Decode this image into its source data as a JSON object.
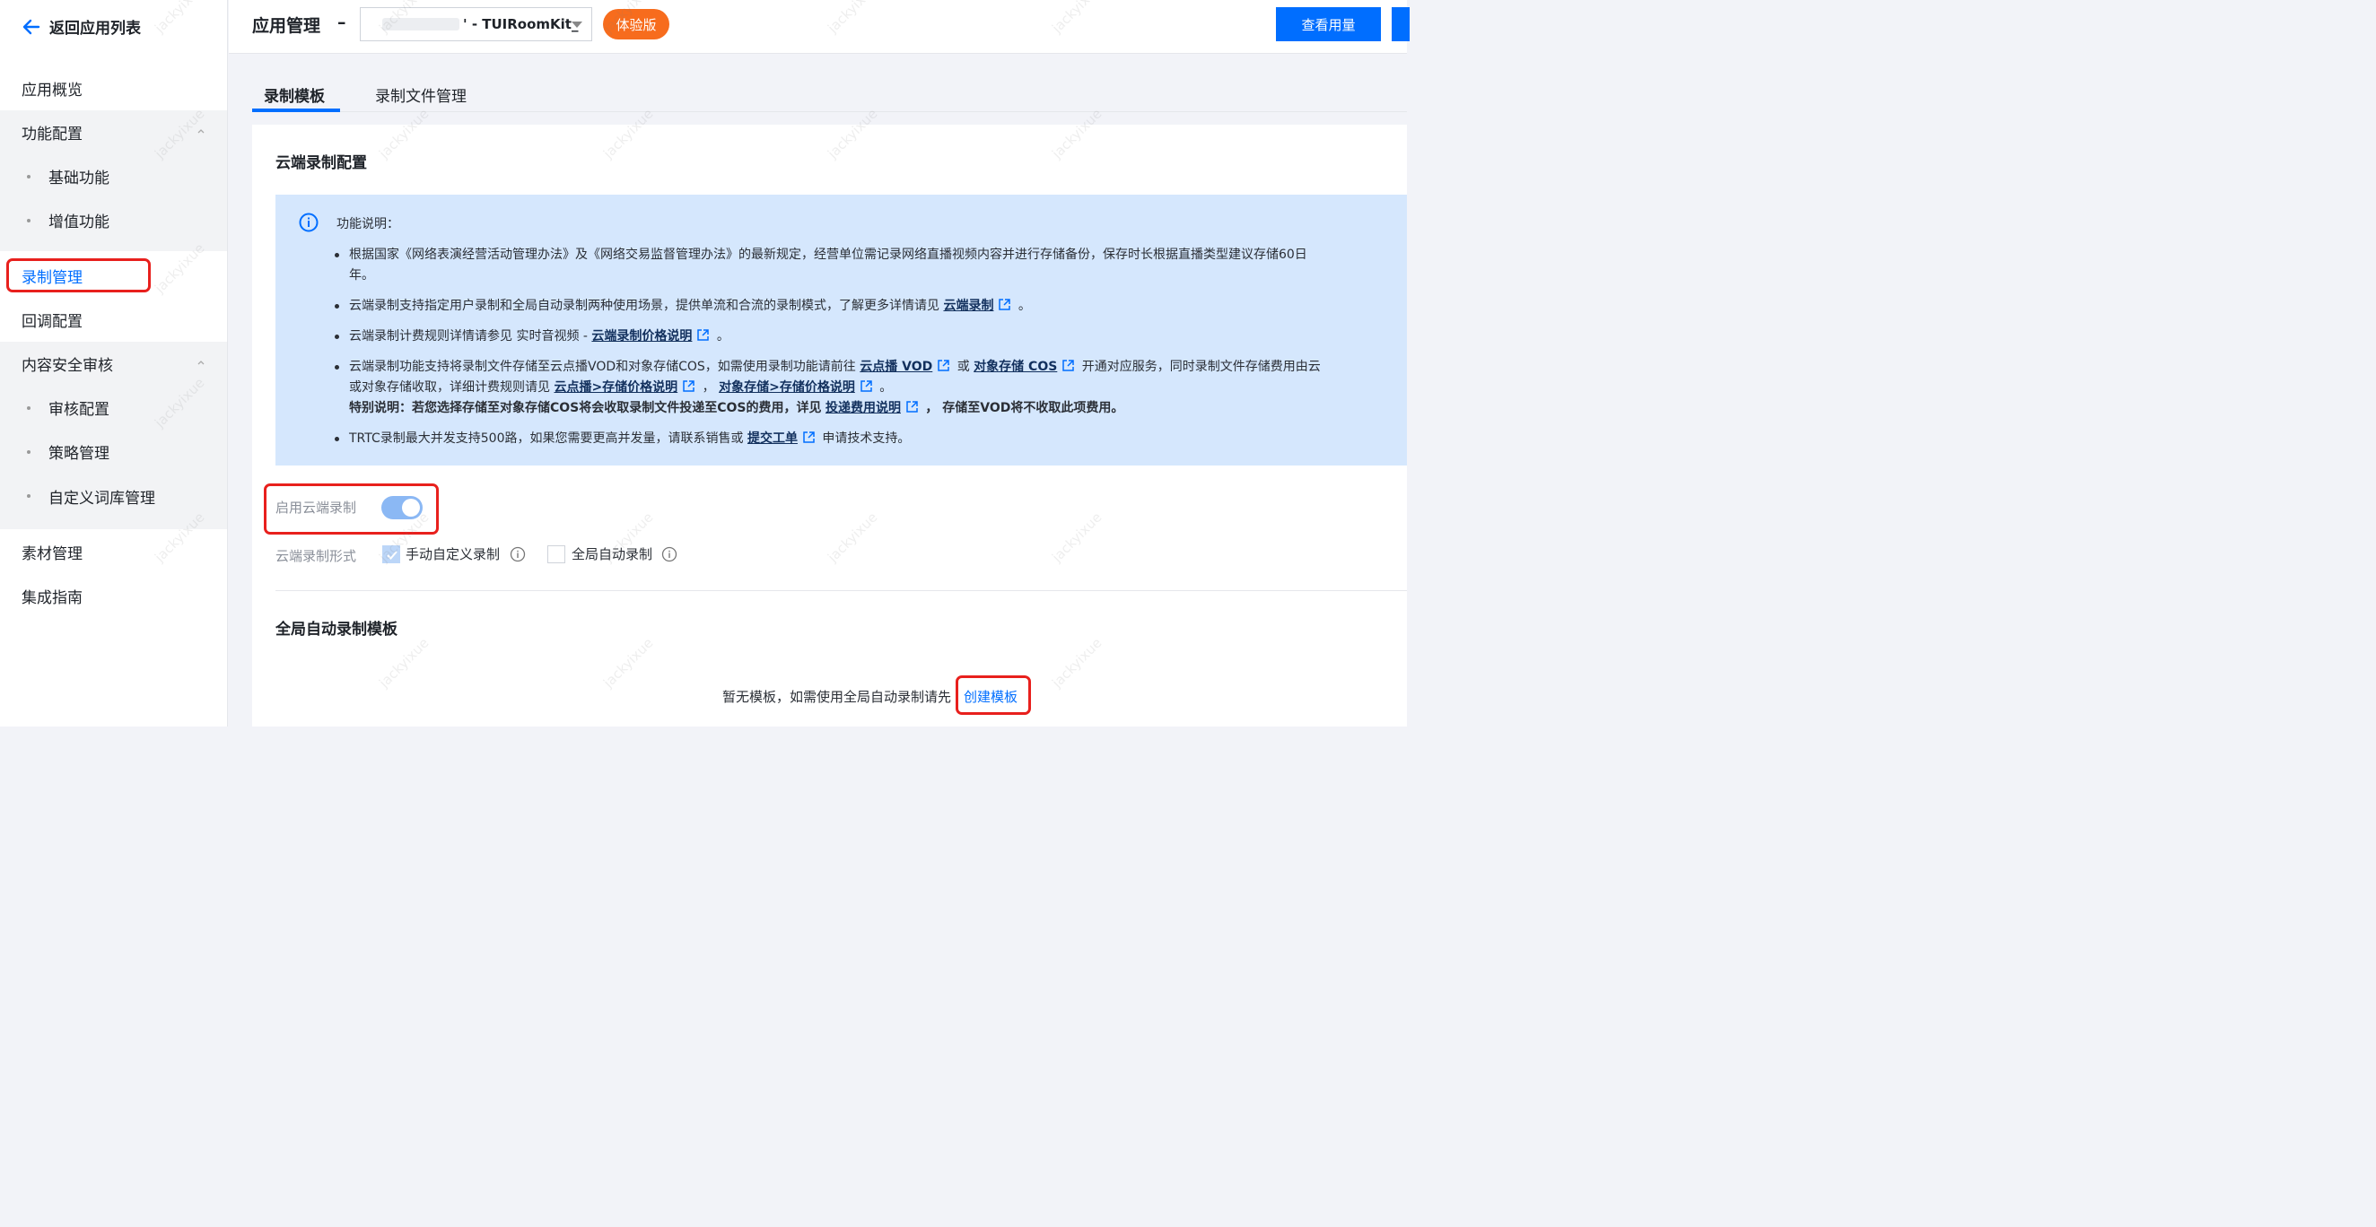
{
  "sidebar": {
    "back_label": "返回应用列表",
    "items": {
      "overview": "应用概览",
      "feature_config": "功能配置",
      "basic": "基础功能",
      "value_added": "增值功能",
      "recording": "录制管理",
      "callback": "回调配置",
      "content_audit": "内容安全审核",
      "audit_config": "审核配置",
      "policy": "策略管理",
      "dictionary": "自定义词库管理",
      "material": "素材管理",
      "guide": "集成指南"
    }
  },
  "topbar": {
    "title": "应用管理",
    "dash": "–",
    "app_name": "' - TUIRoomKit_",
    "badge": "体验版",
    "usage_button": "查看用量"
  },
  "tabs": [
    "录制模板",
    "录制文件管理"
  ],
  "card": {
    "title": "云端录制配置",
    "info": {
      "heading": "功能说明：",
      "b1_line1": "根据国家《网络表演经营活动管理办法》及《网络交易监督管理办法》的最新规定，经营单位需记录网络直播视频内容并进行存储备份，保存时长根据直播类型建议存储60日",
      "b1_line2": "年。",
      "b2_text": "云端录制支持指定用户录制和全局自动录制两种使用场景，提供单流和合流的录制模式，了解更多详情请见",
      "b2_link": "云端录制",
      "b2_end": "。",
      "b3_text": "云端录制计费规则详情请参见 实时音视频 -",
      "b3_link": "云端录制价格说明",
      "b3_end": "。",
      "b4_text1": "云端录制功能支持将录制文件存储至云点播VOD和对象存储COS，如需使用录制功能请前往",
      "b4_link1": "云点播 VOD",
      "b4_or": "或",
      "b4_link2": "对象存储 COS",
      "b4_text2": "开通对应服务，同时录制文件存储费用由云",
      "b4_line2_text": "或对象存储收取，详细计费规则请见",
      "b4_link3": "云点播>存储价格说明",
      "b4_comma": "，",
      "b4_link4": "对象存储>存储价格说明",
      "b4_end": "。",
      "b4_special": "特别说明：若您选择存储至对象存储COS将会收取录制文件投递至COS的费用，详见",
      "b4_link5": "投递费用说明",
      "b4_special_end": "，  存储至VOD将不收取此项费用。",
      "b5_text": "TRTC录制最大并发支持500路，如果您需要更高并发量，请联系销售或",
      "b5_link": "提交工单",
      "b5_end": "申请技术支持。"
    },
    "enable_label": "启用云端录制",
    "enable_value": true,
    "mode_label": "云端录制形式",
    "mode_manual": "手动自定义录制",
    "mode_manual_checked": true,
    "mode_auto": "全局自动录制",
    "mode_auto_checked": false,
    "section_title": "全局自动录制模板",
    "empty_text": "暂无模板，如需使用全局自动录制请先",
    "create_link": "创建模板"
  },
  "watermark": "jackyixue",
  "colors": {
    "primary": "#006eff",
    "badge": "#f76c1d",
    "info_bg": "#d5e7fd",
    "highlight": "#e8201d"
  }
}
